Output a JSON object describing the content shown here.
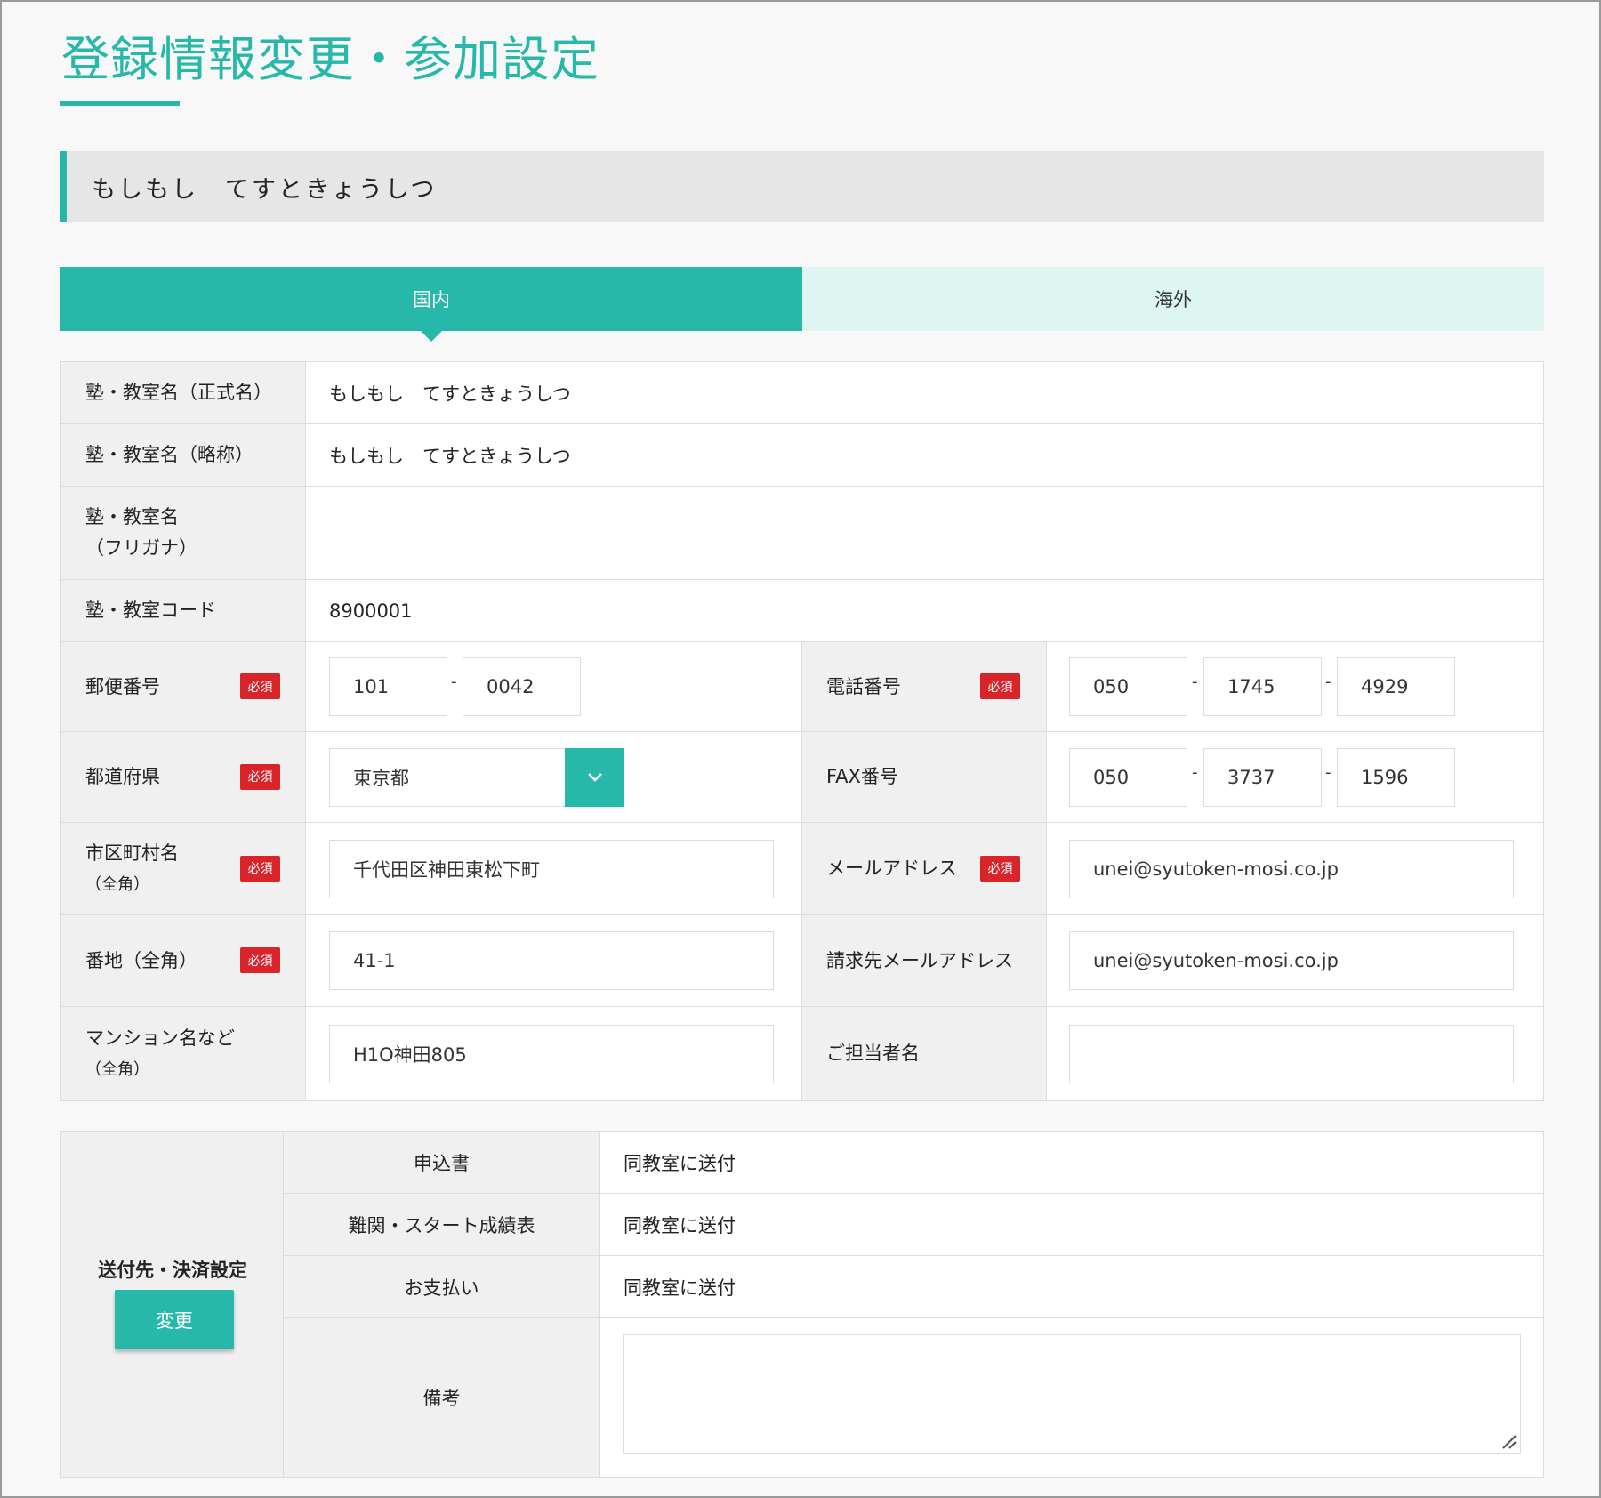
{
  "title": "登録情報変更・参加設定",
  "school_header": "もしもし　てすときょうしつ",
  "tabs": [
    {
      "label": "国内",
      "active": true
    },
    {
      "label": "海外",
      "active": false
    }
  ],
  "required_badge": "必須",
  "info": {
    "official_name": {
      "label": "塾・教室名（正式名）",
      "value": "もしもし　てすときょうしつ"
    },
    "short_name": {
      "label": "塾・教室名（略称）",
      "value": "もしもし　てすときょうしつ"
    },
    "furigana": {
      "label_line1": "塾・教室名",
      "label_line2": "（フリガナ）",
      "value": ""
    },
    "code": {
      "label": "塾・教室コード",
      "value": "8900001"
    },
    "postal": {
      "label": "郵便番号",
      "part1": "101",
      "part2": "0042"
    },
    "phone": {
      "label": "電話番号",
      "part1": "050",
      "part2": "1745",
      "part3": "4929"
    },
    "prefecture": {
      "label": "都道府県",
      "value": "東京都"
    },
    "fax": {
      "label": "FAX番号",
      "part1": "050",
      "part2": "3737",
      "part3": "1596"
    },
    "city": {
      "label_line1": "市区町村名",
      "label_line2": "（全角）",
      "value": "千代田区神田東松下町"
    },
    "email": {
      "label": "メールアドレス",
      "value": "unei@syutoken-mosi.co.jp"
    },
    "address": {
      "label": "番地（全角）",
      "value": "41-1"
    },
    "billing_email": {
      "label": "請求先メールアドレス",
      "value": "unei@syutoken-mosi.co.jp"
    },
    "building": {
      "label_line1": "マンション名など",
      "label_line2": "（全角）",
      "value": "H1O神田805"
    },
    "contact": {
      "label": "ご担当者名",
      "value": ""
    },
    "dash": "-"
  },
  "settings": {
    "title": "送付先・決済設定",
    "change_button": "変更",
    "rows": [
      {
        "label": "申込書",
        "value": "同教室に送付"
      },
      {
        "label": "難関・スタート成績表",
        "value": "同教室に送付"
      },
      {
        "label": "お支払い",
        "value": "同教室に送付"
      }
    ],
    "memo": {
      "label": "備考",
      "value": ""
    }
  },
  "colors": {
    "accent": "#26b8a8",
    "accent_light": "#def6f2",
    "required": "#d9252a"
  }
}
